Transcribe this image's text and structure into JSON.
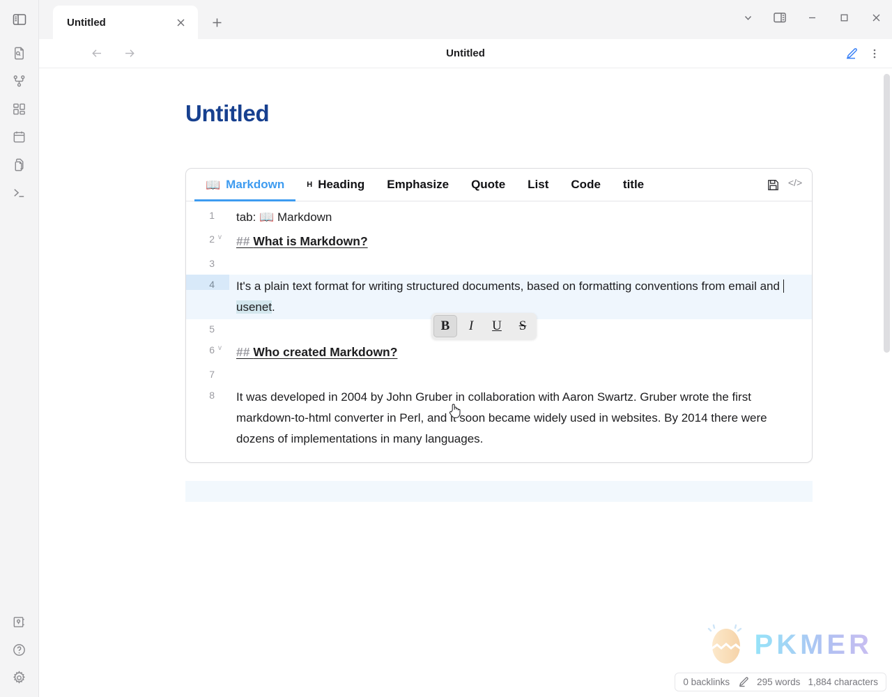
{
  "window": {
    "controls": [
      {
        "name": "chevron-down-icon",
        "label": "⌄"
      },
      {
        "name": "right-sidebar-toggle-icon",
        "label": ""
      },
      {
        "name": "minimize-icon",
        "label": "—"
      },
      {
        "name": "maximize-icon",
        "label": "□"
      },
      {
        "name": "close-icon",
        "label": "✕"
      }
    ]
  },
  "tabbar": {
    "tab_title": "Untitled",
    "close_label": "✕",
    "new_tab_label": "+"
  },
  "ribbon": {
    "top_toggle": "left-sidebar-toggle",
    "items": [
      {
        "icon": "file-search-icon",
        "label": "Search"
      },
      {
        "icon": "git-graph-icon",
        "label": "Graph"
      },
      {
        "icon": "dashboard-grid-icon",
        "label": "Dashboard"
      },
      {
        "icon": "calendar-icon",
        "label": "Calendar"
      },
      {
        "icon": "copy-files-icon",
        "label": "Files"
      },
      {
        "icon": "terminal-icon",
        "label": "Terminal"
      }
    ],
    "bottom_items": [
      {
        "icon": "vault-icon",
        "label": "Vault"
      },
      {
        "icon": "help-circle-icon",
        "label": "Help"
      },
      {
        "icon": "settings-gear-icon",
        "label": "Settings"
      }
    ]
  },
  "dochead": {
    "title": "Untitled",
    "back_label": "←",
    "forward_label": "→",
    "edit_icon": "edit-pencil-icon",
    "more_icon": "more-vertical-icon"
  },
  "document": {
    "page_title": "Untitled"
  },
  "editor": {
    "tabs": [
      {
        "label": "Markdown",
        "icon": "open-book-icon",
        "active": true
      },
      {
        "label": "Heading",
        "prefix": "H",
        "active": false
      },
      {
        "label": "Emphasize",
        "active": false
      },
      {
        "label": "Quote",
        "active": false
      },
      {
        "label": "List",
        "active": false
      },
      {
        "label": "Code",
        "active": false
      },
      {
        "label": "title",
        "active": false
      }
    ],
    "icons": [
      {
        "name": "save-floppy-icon",
        "glyph": ""
      },
      {
        "name": "code-angle-brackets-icon",
        "glyph": "</>"
      }
    ],
    "lines": [
      {
        "num": "1",
        "fold": "",
        "active": false,
        "type": "plain",
        "text": "tab: 📖 Markdown"
      },
      {
        "num": "2",
        "fold": "v",
        "active": false,
        "type": "heading",
        "hash": "## ",
        "text": "What is Markdown?"
      },
      {
        "num": "3",
        "fold": "",
        "active": false,
        "type": "plain",
        "text": ""
      },
      {
        "num": "4",
        "fold": "",
        "active": true,
        "type": "selection",
        "text_before": "It's a plain text format for writing structured documents, based on formatting conventions from email and ",
        "selected": "usenet",
        "text_after": "."
      },
      {
        "num": "5",
        "fold": "",
        "active": false,
        "type": "plain",
        "text": ""
      },
      {
        "num": "6",
        "fold": "v",
        "active": false,
        "type": "heading",
        "hash": "## ",
        "text": "Who created Markdown?"
      },
      {
        "num": "7",
        "fold": "",
        "active": false,
        "type": "plain",
        "text": ""
      },
      {
        "num": "8",
        "fold": "",
        "active": false,
        "type": "plain",
        "text": "It was developed in 2004 by John Gruber in collaboration with Aaron Swartz. Gruber wrote the first markdown-to-html converter in Perl, and it soon became widely used in websites. By 2014 there were dozens of implementations in many languages."
      }
    ]
  },
  "format_popup": {
    "buttons": [
      {
        "name": "bold-button",
        "label": "B",
        "hovered": true
      },
      {
        "name": "italic-button",
        "label": "I",
        "hovered": false
      },
      {
        "name": "underline-button",
        "label": "U",
        "hovered": false
      },
      {
        "name": "strikethrough-button",
        "label": "S",
        "hovered": false
      }
    ]
  },
  "watermark": {
    "text": "PKMER",
    "logo": "cracked-egg-logo"
  },
  "statusbar": {
    "backlinks": "0 backlinks",
    "pencil_icon": "pencil-icon",
    "words": "295 words",
    "characters": "1,884 characters"
  },
  "colors": {
    "accent_blue": "#3d9bf0",
    "title_blue": "#17408f",
    "active_line_bg": "#eff6fd",
    "selection_bg": "#d3e7ee",
    "ribbon_bg": "#f4f4f5"
  }
}
